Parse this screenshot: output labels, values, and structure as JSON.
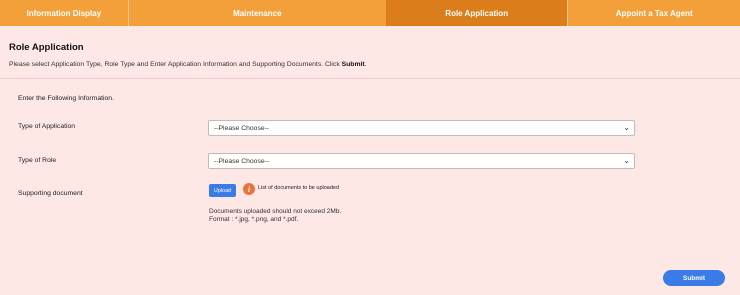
{
  "tabs": [
    {
      "label": "Information Display"
    },
    {
      "label": "Maintenance"
    },
    {
      "label": "Role Application",
      "active": true
    },
    {
      "label": "Appoint a Tax Agent"
    }
  ],
  "section": {
    "title": "Role Application",
    "instructions": "Please select Application Type, Role Type and Enter Application Information and Supporting Documents. Click ",
    "instructions_bold": "Submit",
    "instructions_end": "."
  },
  "form": {
    "header": "Enter the Following Information.",
    "type_of_application": {
      "label": "Type of Application",
      "value": "--Please Choose--"
    },
    "type_of_role": {
      "label": "Type of Role",
      "value": "--Please Choose--"
    },
    "supporting_document": {
      "label": "Supporting document",
      "upload_label": "Upload",
      "doc_list_link": "List of documents to be uploaded",
      "note_size": "Documents uploaded should not exceed 2Mb.",
      "note_format": "Format : *.jpg, *.png, and *.pdf."
    }
  },
  "submit_label": "Submit",
  "colors": {
    "tab": "#f3a03a",
    "tab_active": "#db7d1a",
    "background": "#fde8e6",
    "button": "#3b7be8",
    "info_icon": "#e8743b"
  },
  "icons": {
    "info": "info-icon",
    "dropdown": "chevron-down-icon"
  }
}
